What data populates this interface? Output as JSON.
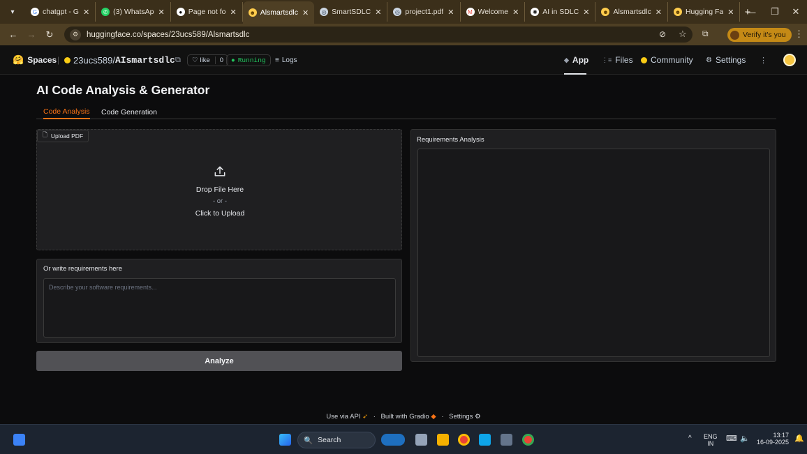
{
  "browser": {
    "tabs": [
      {
        "title": "chatgpt - G",
        "favicon": "google-icon"
      },
      {
        "title": "(3) WhatsAp",
        "favicon": "whatsapp-icon"
      },
      {
        "title": "Page not fo",
        "favicon": "github-icon"
      },
      {
        "title": "Alsmartsdlc",
        "favicon": "huggingface-icon",
        "active": true
      },
      {
        "title": "SmartSDLC",
        "favicon": "globe-icon"
      },
      {
        "title": "project1.pdf",
        "favicon": "globe-icon"
      },
      {
        "title": "Welcome",
        "favicon": "gmail-icon"
      },
      {
        "title": "AI in SDLC",
        "favicon": "openai-icon"
      },
      {
        "title": "Alsmartsdlc",
        "favicon": "huggingface-icon"
      },
      {
        "title": "Hugging Fa",
        "favicon": "huggingface-icon"
      }
    ],
    "url": "huggingface.co/spaces/23ucs589/Alsmartsdlc",
    "verify_label": "Verify it's you"
  },
  "hf_header": {
    "spaces_label": "Spaces",
    "owner": "23ucs589/",
    "repo": "AIsmartsdlc",
    "like_label": "like",
    "like_count": "0",
    "status": "Running",
    "logs_label": "Logs",
    "nav": {
      "app": "App",
      "files": "Files",
      "community": "Community",
      "settings": "Settings"
    }
  },
  "app": {
    "title": "AI Code Analysis & Generator",
    "tabs": [
      "Code Analysis",
      "Code Generation"
    ],
    "upload": {
      "label": "Upload PDF",
      "drop_text": "Drop File Here",
      "or_text": "- or -",
      "click_text": "Click to Upload"
    },
    "requirements": {
      "label": "Or write requirements here",
      "placeholder": "Describe your software requirements..."
    },
    "analyze_button": "Analyze",
    "analysis": {
      "label": "Requirements Analysis"
    }
  },
  "footer": {
    "api": "Use via API",
    "built": "Built with Gradio",
    "settings": "Settings",
    "sep": "·"
  },
  "taskbar": {
    "search_label": "Search",
    "lang_top": "ENG",
    "lang_bottom": "IN",
    "time": "13:17",
    "date": "16-09-2025"
  },
  "colors": {
    "accent": "#f97316",
    "running": "#22c55e",
    "browser_frame": "#3b2f1a"
  }
}
